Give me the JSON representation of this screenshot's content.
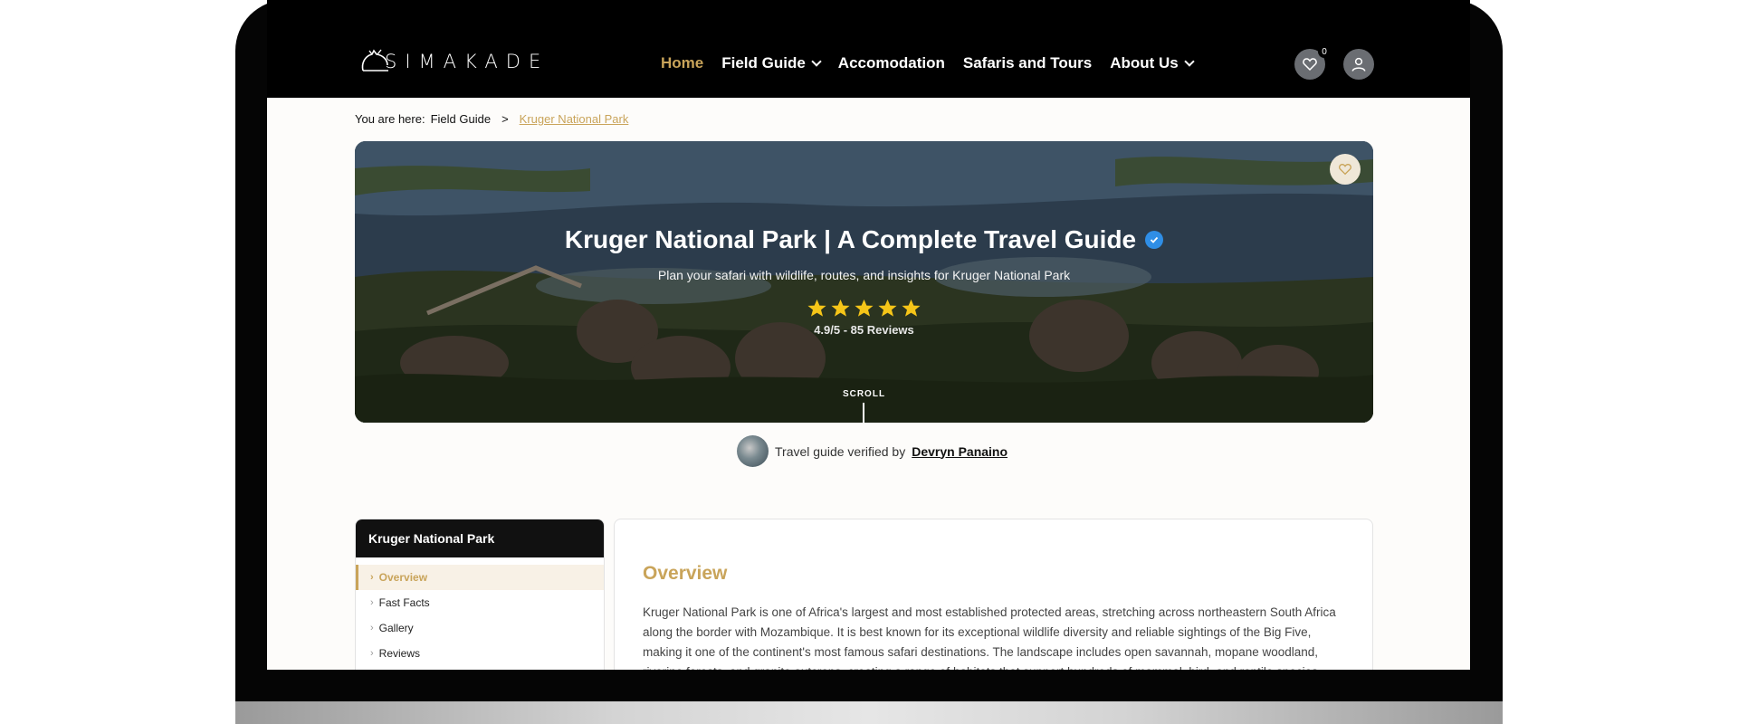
{
  "brand": {
    "logo_text": "SIMAKADE"
  },
  "nav": {
    "items": [
      {
        "label": "Home",
        "active": true,
        "dropdown": false
      },
      {
        "label": "Field Guide",
        "active": false,
        "dropdown": true
      },
      {
        "label": "Accomodation",
        "active": false,
        "dropdown": false
      },
      {
        "label": "Safaris and Tours",
        "active": false,
        "dropdown": false
      },
      {
        "label": "About Us",
        "active": false,
        "dropdown": true
      }
    ],
    "favorites_count": "0"
  },
  "breadcrumb": {
    "prefix": "You are here:",
    "parent": "Field Guide",
    "separator": ">",
    "current": "Kruger National Park"
  },
  "hero": {
    "title": "Kruger National Park | A Complete Travel Guide",
    "subtitle": "Plan your safari with wildlife, routes, and insights for Kruger National Park",
    "rating_text": "4.9/5 - 85 Reviews",
    "stars": 5,
    "scroll_label": "SCROLL"
  },
  "verified": {
    "prefix": "Travel guide verified by",
    "name": "Devryn Panaino"
  },
  "sidebar": {
    "title": "Kruger National Park",
    "items": [
      {
        "label": "Overview",
        "active": true
      },
      {
        "label": "Fast Facts",
        "active": false
      },
      {
        "label": "Gallery",
        "active": false
      },
      {
        "label": "Reviews",
        "active": false
      }
    ]
  },
  "content": {
    "heading": "Overview",
    "body": "Kruger National Park is one of Africa's largest and most established protected areas, stretching across northeastern South Africa along the border with Mozambique. It is best known for its exceptional wildlife diversity and reliable sightings of the Big Five, making it one of the continent's most famous safari destinations. The landscape includes open savannah, mopane woodland, riverine forests, and granite outcrops, creating a range of habitats that support hundreds of mammal, bird, and reptile species."
  },
  "colors": {
    "accent": "#c9a45a",
    "header_bg": "#000000",
    "verified_blue": "#2f8ee6",
    "star": "#f5c518"
  }
}
